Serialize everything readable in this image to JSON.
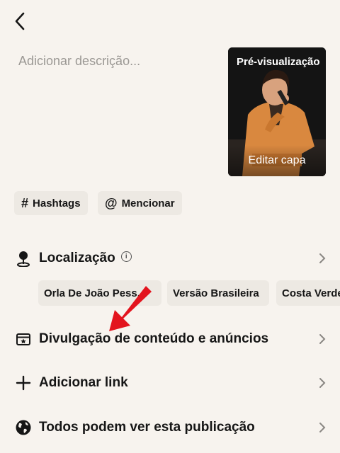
{
  "header": {
    "back_icon": "chevron-left-icon"
  },
  "description": {
    "placeholder": "Adicionar descrição..."
  },
  "cover": {
    "title": "Pré-visualização",
    "edit_label": "Editar capa"
  },
  "chips": [
    {
      "symbol": "#",
      "label": "Hashtags"
    },
    {
      "symbol": "@",
      "label": "Mencionar"
    }
  ],
  "rows": {
    "location": {
      "label": "Localização",
      "icon": "map-pin-icon",
      "info": "i"
    },
    "disclosure": {
      "label": "Divulgação de conteúdo e anúncios",
      "icon": "content-disclosure-icon"
    },
    "link": {
      "label": "Adicionar link",
      "icon": "plus-icon"
    },
    "privacy": {
      "label": "Todos podem ver esta publicação",
      "icon": "globe-icon"
    }
  },
  "location_suggestions": [
    "Orla De João Pess...",
    "Versão Brasileira",
    "Costa Verde"
  ],
  "colors": {
    "background": "#f7f3ee",
    "chip": "#ede9e3",
    "text": "#161616",
    "placeholder": "#9b9894",
    "annotation_arrow": "#e3141e"
  }
}
